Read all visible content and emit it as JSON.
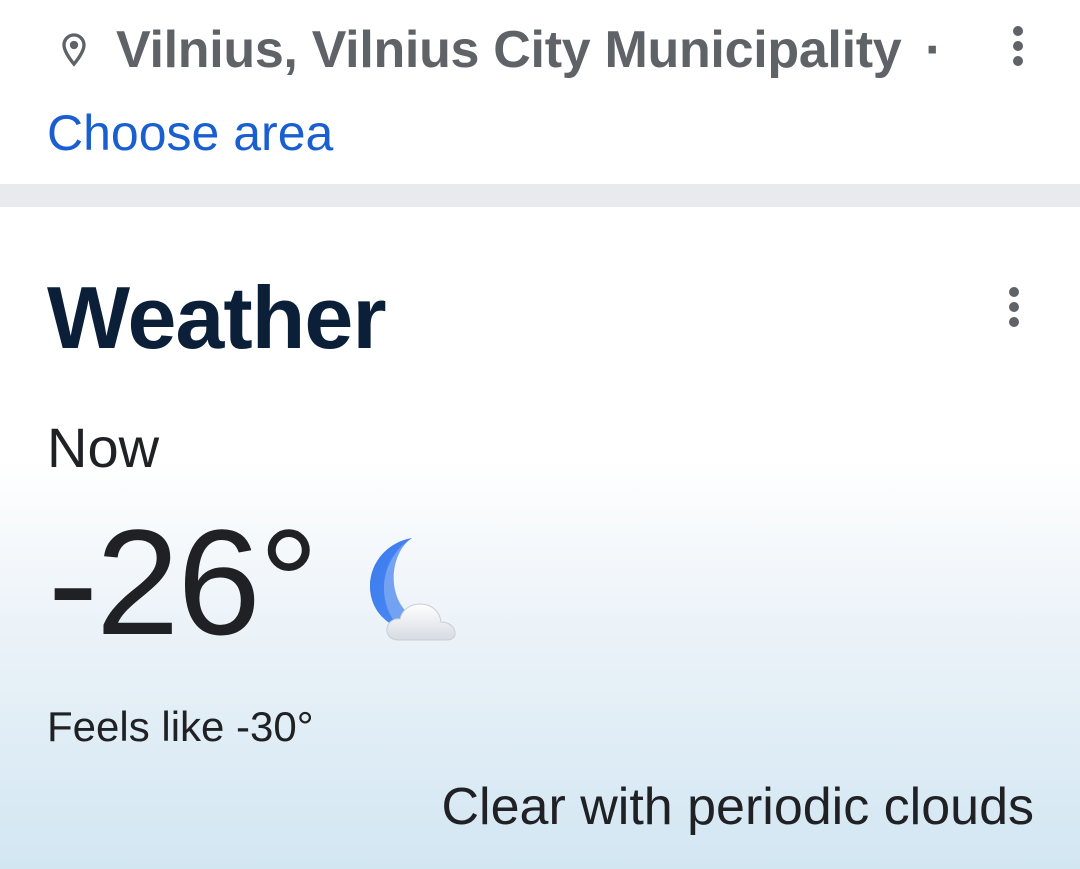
{
  "location": {
    "text": "Vilnius, Vilnius City Municipality",
    "separator": "·",
    "choose_area_label": "Choose area",
    "pin_icon": "location-pin-icon",
    "menu_icon": "more-vert-icon"
  },
  "weather": {
    "title": "Weather",
    "now_label": "Now",
    "temperature": "-26°",
    "condition_icon": "moon-cloud-icon",
    "feels_like": "Feels like -30°",
    "condition": "Clear with periodic clouds",
    "menu_icon": "more-vert-icon"
  },
  "colors": {
    "link": "#1a5fd0",
    "title": "#0b2038",
    "muted": "#5f6368",
    "divider": "#e8eaed",
    "moon": "#4a86f0"
  }
}
